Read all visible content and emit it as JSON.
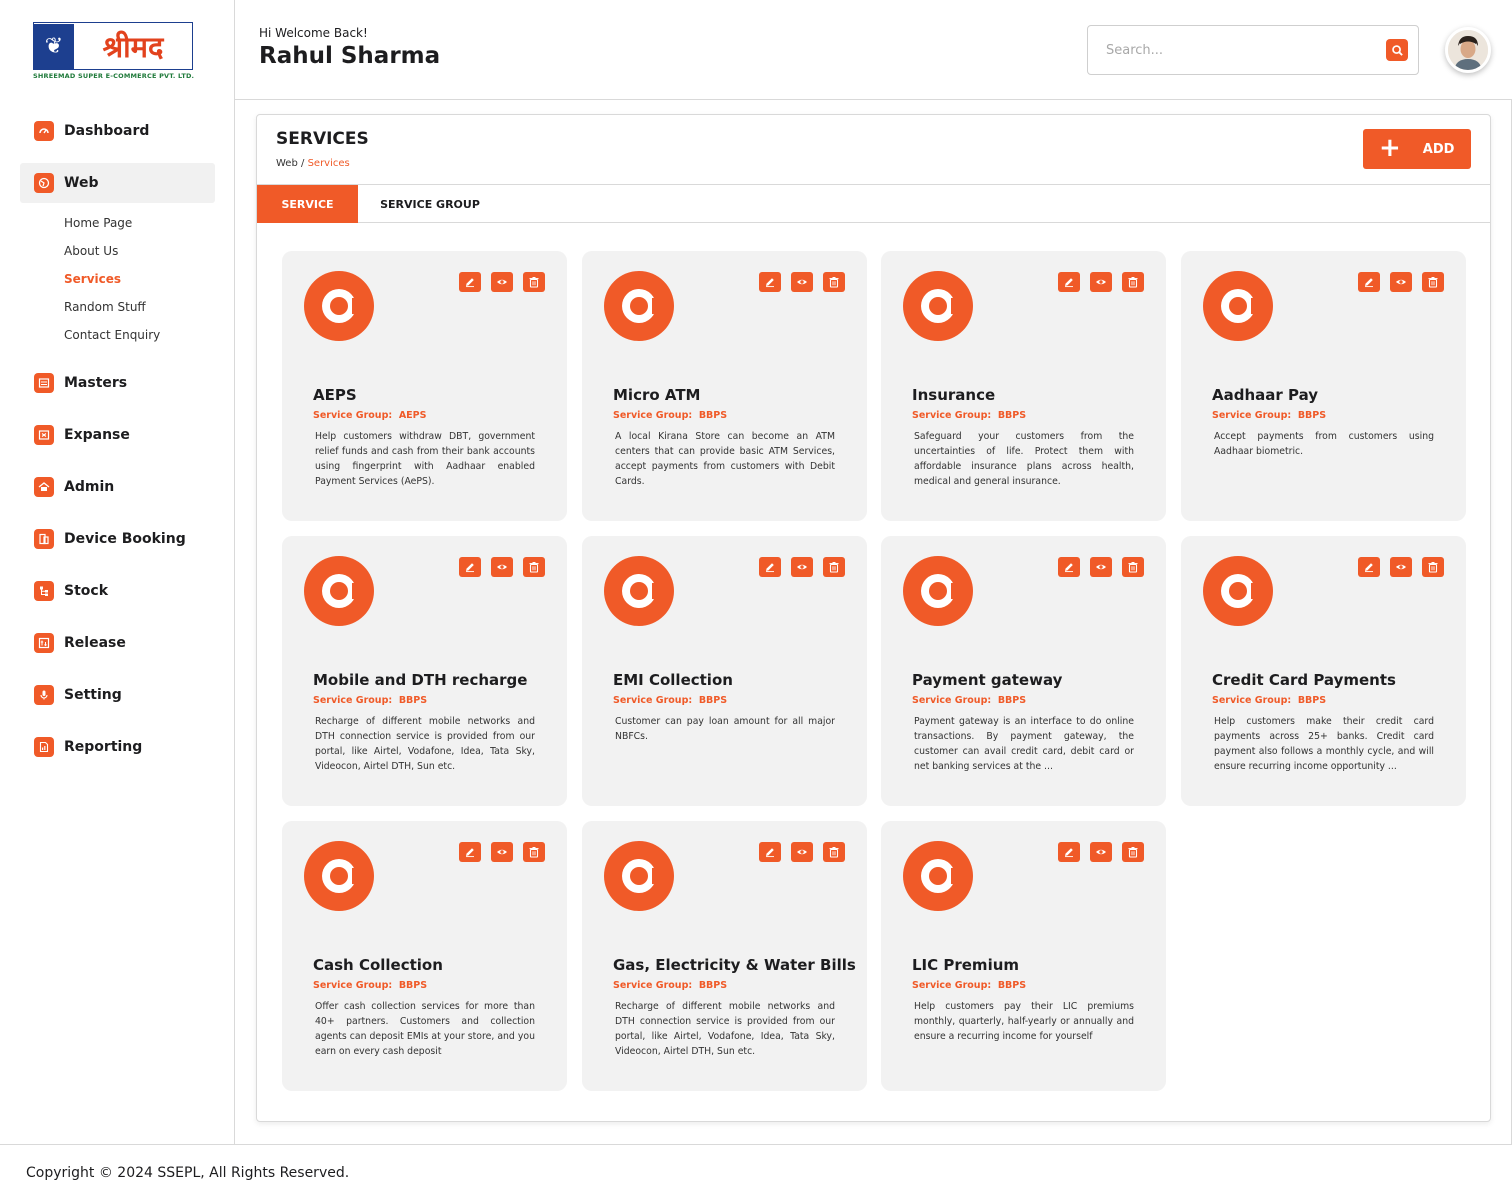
{
  "brand": {
    "logo_text": "श्रीमद",
    "logo_subtitle": "SHREEMAD SUPER E-COMMERCE PVT. LTD."
  },
  "header": {
    "welcome": "Hi Welcome Back!",
    "user_name": "Rahul Sharma",
    "search_placeholder": "Search..."
  },
  "sidebar": {
    "items": [
      {
        "label": "Dashboard",
        "icon": "dashboard-icon"
      },
      {
        "label": "Web",
        "icon": "globe-icon",
        "active": true,
        "children": [
          "Home Page",
          "About Us",
          "Services",
          "Random Stuff",
          "Contact Enquiry"
        ],
        "current_child": "Services"
      },
      {
        "label": "Masters",
        "icon": "masters-icon"
      },
      {
        "label": "Expanse",
        "icon": "expense-icon"
      },
      {
        "label": "Admin",
        "icon": "admin-icon"
      },
      {
        "label": "Device Booking",
        "icon": "device-booking-icon"
      },
      {
        "label": "Stock",
        "icon": "stock-icon"
      },
      {
        "label": "Release",
        "icon": "release-icon"
      },
      {
        "label": "Setting",
        "icon": "setting-icon"
      },
      {
        "label": "Reporting",
        "icon": "reporting-icon"
      }
    ]
  },
  "page": {
    "title": "SERVICES",
    "breadcrumb_root": "Web",
    "breadcrumb_separator": "/",
    "breadcrumb_current": "Services",
    "add_label": "ADD",
    "tabs": [
      "SERVICE",
      "SERVICE GROUP"
    ],
    "active_tab": "SERVICE"
  },
  "cards": [
    {
      "title": "AEPS",
      "group_label": "Service Group:",
      "group": "AEPS",
      "description": "Help customers withdraw DBT, government relief funds and cash from their bank accounts using fingerprint with Aadhaar enabled Payment Services (AePS)."
    },
    {
      "title": "Micro ATM",
      "group_label": "Service Group:",
      "group": "BBPS",
      "description": "A local Kirana Store can become an ATM centers that can provide basic ATM Services, accept payments from customers with Debit Cards."
    },
    {
      "title": "Insurance",
      "group_label": "Service Group:",
      "group": "BBPS",
      "description": "Safeguard your customers from the uncertainties of life. Protect them with affordable insurance plans across health, medical and general insurance."
    },
    {
      "title": "Aadhaar Pay",
      "group_label": "Service Group:",
      "group": "BBPS",
      "description": "Accept payments from customers using Aadhaar biometric."
    },
    {
      "title": "Mobile and DTH recharge",
      "group_label": "Service Group:",
      "group": "BBPS",
      "description": "Recharge of different mobile networks and DTH connection service is provided from our portal, like Airtel, Vodafone, Idea, Tata Sky, Videocon, Airtel DTH, Sun etc."
    },
    {
      "title": "EMI Collection",
      "group_label": "Service Group:",
      "group": "BBPS",
      "description": "Customer can pay loan amount for all major NBFCs."
    },
    {
      "title": "Payment gateway",
      "group_label": "Service Group:",
      "group": "BBPS",
      "description": "Payment gateway is an interface to do online transactions. By payment gateway, the customer can avail credit card, debit card or net banking services at the ..."
    },
    {
      "title": "Credit Card Payments",
      "group_label": "Service Group:",
      "group": "BBPS",
      "description": "Help customers make their credit card payments across 25+ banks. Credit card payment also follows a monthly cycle, and will ensure recurring income opportunity ..."
    },
    {
      "title": "Cash Collection",
      "group_label": "Service Group:",
      "group": "BBPS",
      "description": "Offer cash collection services for more than 40+ partners. Customers and collection agents can deposit EMIs at your store, and you earn on every cash deposit"
    },
    {
      "title": "Gas, Electricity & Water Bills",
      "group_label": "Service Group:",
      "group": "BBPS",
      "description": "Recharge of different mobile networks and DTH connection service is provided from our portal, like Airtel, Vodafone, Idea, Tata Sky, Videocon, Airtel DTH, Sun etc."
    },
    {
      "title": "LIC Premium",
      "group_label": "Service Group:",
      "group": "BBPS",
      "description": "Help customers pay their LIC premiums monthly, quarterly, half-yearly or annually and ensure a recurring income for yourself"
    }
  ],
  "footer": {
    "copyright": "Copyright © 2024 SSEPL, All Rights Reserved."
  },
  "colors": {
    "accent": "#f05a28",
    "card_bg": "#f2f2f2",
    "active_nav_bg": "#f1f1f1"
  }
}
